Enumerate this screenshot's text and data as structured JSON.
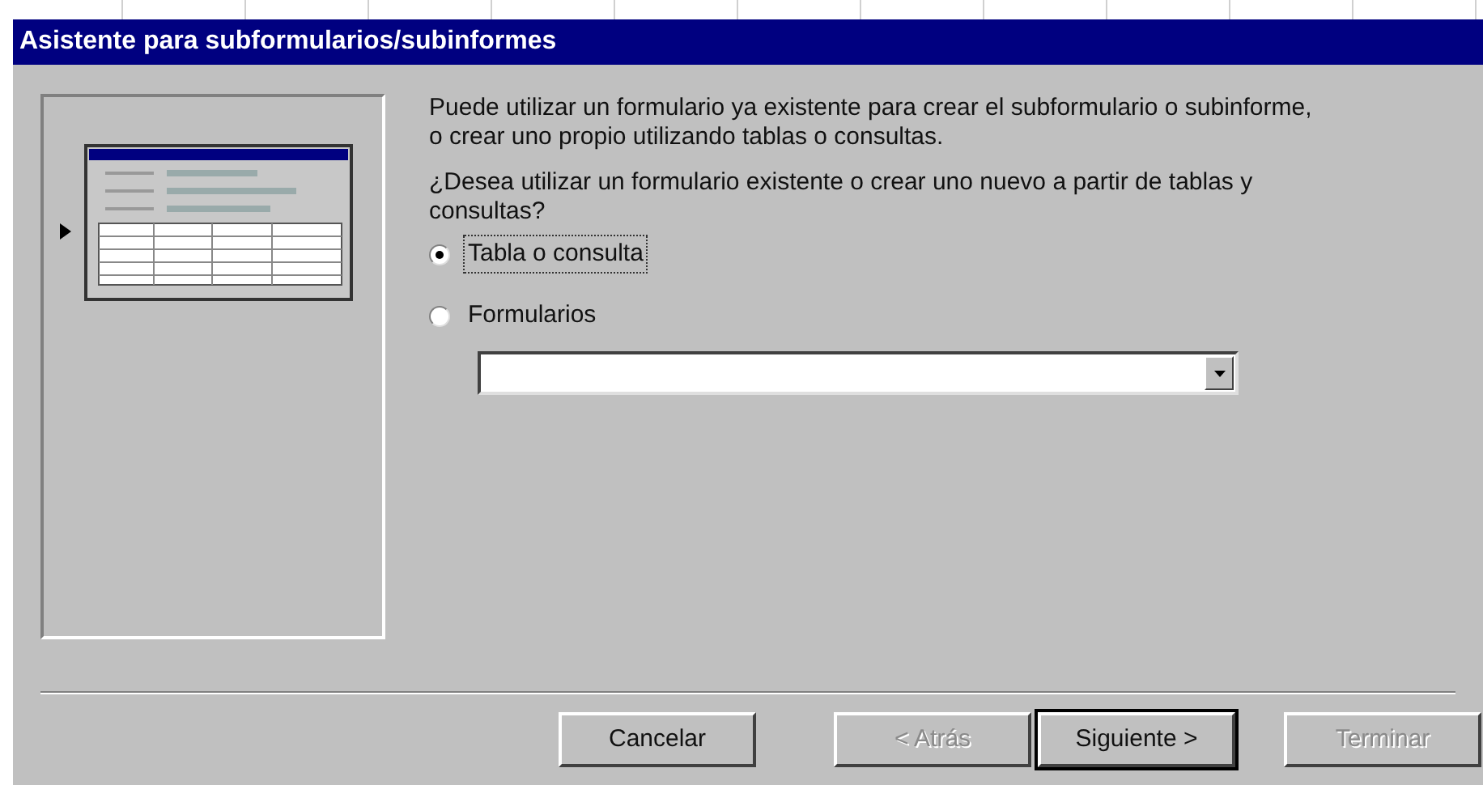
{
  "window": {
    "title": "Asistente para subformularios/subinformes"
  },
  "description": "Puede utilizar un formulario ya existente para crear el subformulario o subinforme, o crear uno propio utilizando tablas o consultas.",
  "question": "¿Desea utilizar un formulario existente o crear uno nuevo a partir de tablas y consultas?",
  "options": [
    {
      "label": "Tabla o consulta",
      "selected": true
    },
    {
      "label": "Formularios",
      "selected": false
    }
  ],
  "buttons": [
    {
      "label": "Cancelar",
      "disabled": false,
      "default": false
    },
    {
      "label": "< Atrás",
      "disabled": true,
      "default": false
    },
    {
      "label": "Siguiente >",
      "disabled": false,
      "default": true
    },
    {
      "label": "Terminar",
      "disabled": true,
      "default": false
    }
  ]
}
